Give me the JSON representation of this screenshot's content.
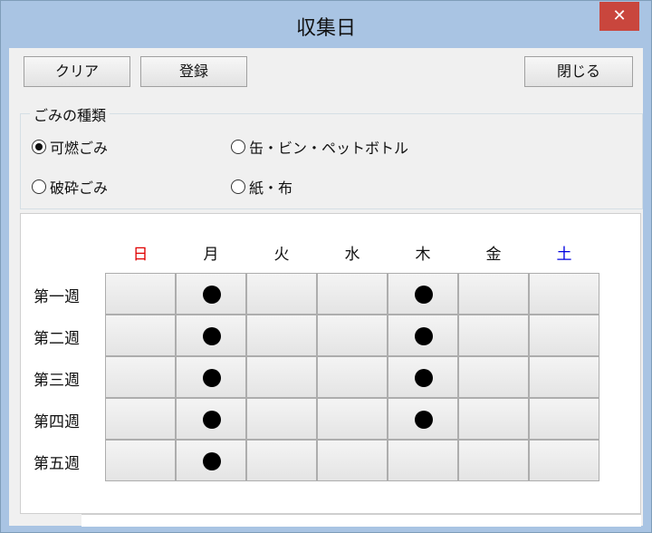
{
  "window": {
    "title": "収集日",
    "close_glyph": "✕"
  },
  "toolbar": {
    "clear_label": "クリア",
    "register_label": "登録",
    "close_label": "閉じる"
  },
  "garbage": {
    "group_label": "ごみの種類",
    "options": [
      {
        "label": "可燃ごみ",
        "selected": true
      },
      {
        "label": "缶・ビン・ペットボトル",
        "selected": false
      },
      {
        "label": "破砕ごみ",
        "selected": false
      },
      {
        "label": "紙・布",
        "selected": false
      }
    ]
  },
  "calendar": {
    "days": [
      "日",
      "月",
      "火",
      "水",
      "木",
      "金",
      "土"
    ],
    "day_colors": [
      "#e00000",
      "#111111",
      "#111111",
      "#111111",
      "#111111",
      "#111111",
      "#0000e0"
    ],
    "weeks": [
      "第一週",
      "第二週",
      "第三週",
      "第四週",
      "第五週"
    ],
    "marks": [
      [
        false,
        true,
        false,
        false,
        true,
        false,
        false
      ],
      [
        false,
        true,
        false,
        false,
        true,
        false,
        false
      ],
      [
        false,
        true,
        false,
        false,
        true,
        false,
        false
      ],
      [
        false,
        true,
        false,
        false,
        true,
        false,
        false
      ],
      [
        false,
        true,
        false,
        false,
        false,
        false,
        false
      ]
    ]
  }
}
